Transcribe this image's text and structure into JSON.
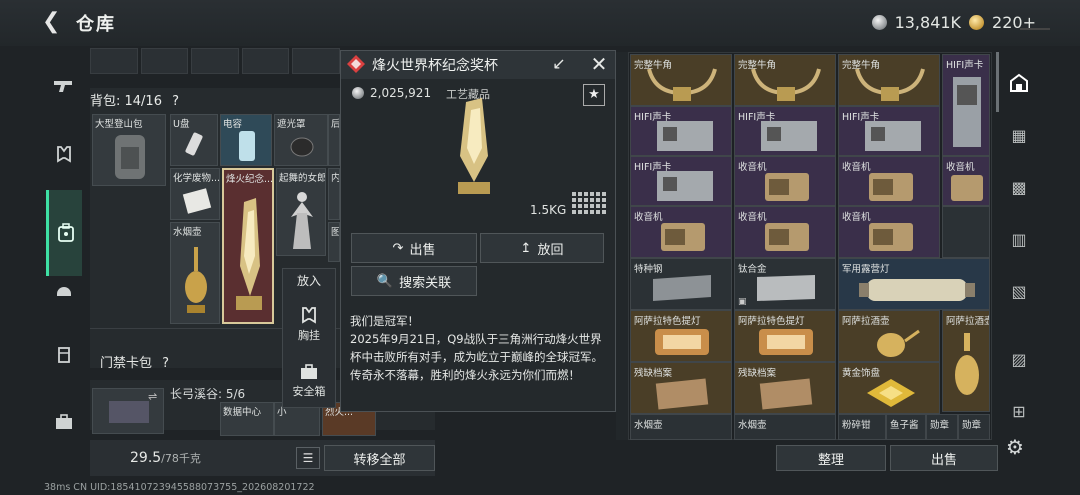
{
  "header": {
    "title": "仓库",
    "silver": "13,841K",
    "gold": "220+"
  },
  "backpack": {
    "label": "背包: 14/16",
    "help": "?",
    "cells": [
      {
        "label": "大型登山包"
      },
      {
        "label": "U盘"
      },
      {
        "label": "电容"
      },
      {
        "label": "遮光罩"
      },
      {
        "label": "后"
      },
      {
        "label": "化学废物..."
      },
      {
        "label": "烽火纪念..."
      },
      {
        "label": "起舞的女郎"
      },
      {
        "label": "内"
      },
      {
        "label": "水烟壶"
      },
      {
        "label": "图"
      }
    ],
    "bag_card_label": "门禁卡包",
    "bag_card_help": "?",
    "lower_label": "长弓溪谷: 5/6",
    "lower_cells": [
      "数据中心",
      "小",
      "烈火..."
    ]
  },
  "putin": {
    "title": "放入",
    "options": [
      {
        "label": "胸挂"
      },
      {
        "label": "安全箱"
      }
    ]
  },
  "detail": {
    "title": "烽火世界杯纪念奖杯",
    "price": "2,025,921",
    "category": "工艺藏品",
    "weight": "1.5KG",
    "sell_label": "出售",
    "return_label": "放回",
    "search_label": "搜索关联",
    "description": "我们是冠军！\n2025年9月21日，Q9战队于三角洲行动烽火世界杯中击败所有对手，成为屹立于巅峰的全球冠军。传奇永不落幕，胜利的烽火永远为你们而燃！"
  },
  "stash": {
    "cells": [
      {
        "label": "完整牛角"
      },
      {
        "label": "完整牛角"
      },
      {
        "label": "完整牛角"
      },
      {
        "label": "HIFI声卡"
      },
      {
        "label": "HIFI声卡"
      },
      {
        "label": "HIFI声卡"
      },
      {
        "label": "HIFI声卡"
      },
      {
        "label": "HIFI声卡"
      },
      {
        "label": "收音机"
      },
      {
        "label": "收音机"
      },
      {
        "label": "收音机"
      },
      {
        "label": "收音机"
      },
      {
        "label": "收音机"
      },
      {
        "label": "收音机"
      },
      {
        "label": "特种钢"
      },
      {
        "label": "钛合金"
      },
      {
        "label": "军用露营灯"
      },
      {
        "label": "阿萨拉特色提灯"
      },
      {
        "label": "阿萨拉特色提灯"
      },
      {
        "label": "阿萨拉酒壶"
      },
      {
        "label": "阿萨拉酒壶"
      },
      {
        "label": "残缺档案"
      },
      {
        "label": "残缺档案"
      },
      {
        "label": "黄金饰盘"
      },
      {
        "label": "水烟壶"
      },
      {
        "label": "水烟壶"
      },
      {
        "label": "粉碎钳"
      },
      {
        "label": "鱼子酱"
      },
      {
        "label": "勋章"
      },
      {
        "label": "勋章"
      }
    ]
  },
  "footer": {
    "weight": "29.5",
    "weight_max": "/78千克",
    "transfer_all": "转移全部",
    "sort": "整理",
    "sell": "出售",
    "status": "38ms    CN UID:18541072394558807375​5_202608201722"
  },
  "colors": {
    "accent": "#3ee0a4",
    "selected_cell": "#5a2f30",
    "gold_bg": "#4a3e27"
  }
}
